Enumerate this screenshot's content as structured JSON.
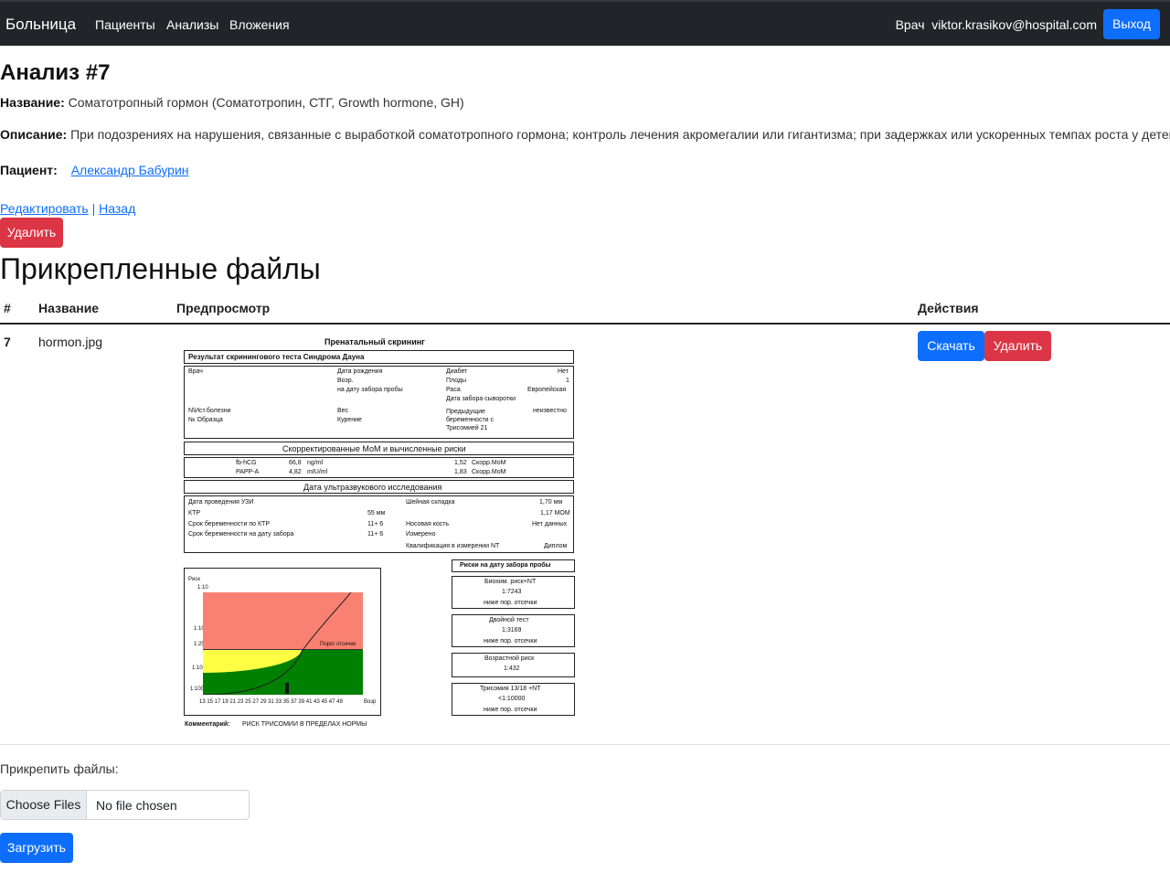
{
  "nav": {
    "brand": "Больница",
    "links": [
      "Пациенты",
      "Анализы",
      "Вложения"
    ],
    "user_role": "Врач",
    "user_email": "viktor.krasikov@hospital.com",
    "logout": "Выход"
  },
  "analysis": {
    "title": "Анализ #7",
    "name_label": "Название:",
    "name_value": "Соматотропный гормон (Соматотропин, СТГ, Growth hormone, GH)",
    "desc_label": "Описание:",
    "desc_value": "При подозрениях на нарушения, связанные с выработкой соматотропного гормона; контроль лечения акромегалии или гигантизма; при задержках или ускоренных темпах роста у детей.",
    "patient_label": "Пациент:",
    "patient_value": "Александр Бабурин",
    "edit_link": "Редактировать",
    "separator": "|",
    "back_link": "Назад",
    "delete": "Удалить"
  },
  "files": {
    "heading": "Прикрепленные файлы",
    "columns": [
      "#",
      "Название",
      "Предпросмотр",
      "Действия"
    ],
    "rows": [
      {
        "id": "7",
        "name": "hormon.jpg",
        "download": "Скачать",
        "delete": "Удалить"
      }
    ]
  },
  "preview_doc": {
    "title": "Пренатальный скрининг",
    "result_header": "Результат скринингового теста Синдрома Дауна",
    "info": {
      "doctor": "Врач",
      "birth_date": "Дата рождения",
      "age": "Возр.",
      "age_at_sample": "на дату забора пробы",
      "diabetes": "Диабет",
      "diabetes_val": "Нет",
      "fetuses": "Плоды",
      "fetuses_val": "1",
      "race": "Раса",
      "race_val": "Европейская",
      "serum_date": "Дата забора сыворотки",
      "history_no": "N\\Ист.болезни",
      "weight": "Вес",
      "prev_preg": "Предыдущие беременности с Трисомией 21",
      "prev_preg_val": "неизвестно",
      "sample_no": "№ Образца",
      "smoking": "Курение"
    },
    "mom_header": "Скорректированные МоМ и вычисленные риски",
    "markers": [
      {
        "name": "fb-hCG",
        "value": "66,8",
        "unit": "ng/ml",
        "mom": "1,52",
        "mom_label": "Скорр.МоМ"
      },
      {
        "name": "PAPP-A",
        "value": "4,82",
        "unit": "mIU/ml",
        "mom": "1,83",
        "mom_label": "Скорр.МоМ"
      }
    ],
    "us_header": "Дата ультразвукового исследования",
    "us": {
      "date": "Дата проведения УЗИ",
      "ktr": "КТР",
      "ktr_val": "55 мм",
      "term_ktr": "Срок беременности по КТР",
      "term_ktr_val": "11+ 6",
      "term_sample": "Срок беременности на дату забора",
      "term_sample_val": "11+ 6",
      "nt": "Шейная складка",
      "nt_val": "1,70 мм",
      "nt_mom": "1,17 МОМ",
      "nasal": "Носовая кость",
      "nasal_val": "Нет данных",
      "measured": "Измерено",
      "qual": "Квалификация в измерении NT",
      "qual_val": "Диплом"
    },
    "chart_labels": {
      "risk": "Риск",
      "y_ticks": [
        "1:10",
        "1:100",
        "1:250",
        "1:1000",
        "1:10000"
      ],
      "threshold": "Порог отсечки",
      "x_ticks": "13 15 17 19 21 23 25 27 29 31 33 35 37 39 41 43 45 47 49",
      "x_label": "Возр"
    },
    "risks_header": "Риски на дату забора пробы",
    "risks": [
      {
        "name": "Биохим. риск+NT",
        "value": "1:7243",
        "note": "ниже пор. отсечки"
      },
      {
        "name": "Двойной тест",
        "value": "1:3169",
        "note": "ниже пор. отсечки"
      },
      {
        "name": "Возрастной риск",
        "value": "1:432",
        "note": ""
      },
      {
        "name": "Трисомия 13/18 +NT",
        "value": "<1:10000",
        "note": "ниже пор. отсечки"
      }
    ],
    "comment_label": "Комментарий:",
    "comment": "РИСК ТРИСОМИИ В ПРЕДЕЛАХ НОРМЫ"
  },
  "upload": {
    "label": "Прикрепить файлы:",
    "choose": "Choose Files",
    "no_file": "No file chosen",
    "submit": "Загрузить"
  }
}
